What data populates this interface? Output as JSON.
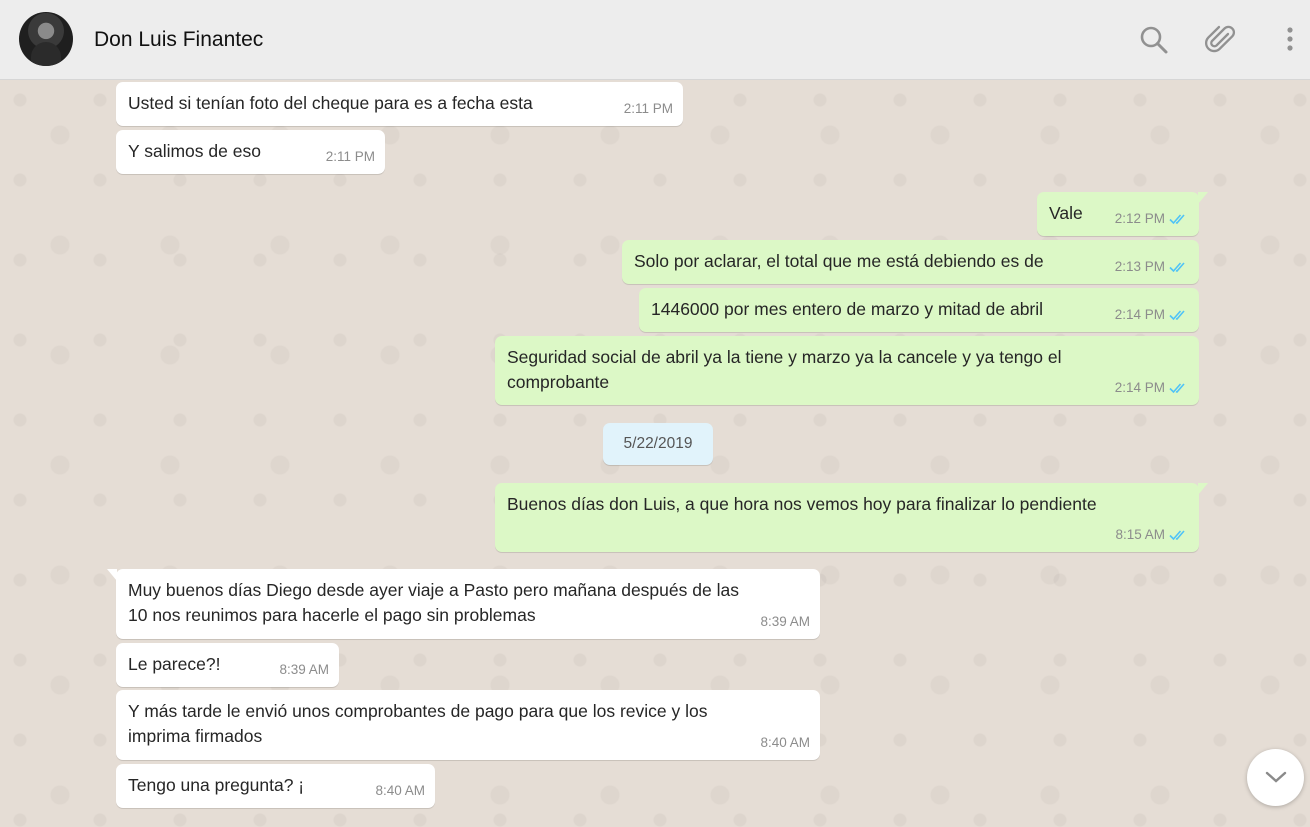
{
  "header": {
    "contact_name": "Don Luis Finantec",
    "icons": [
      "search-icon",
      "attach-icon",
      "menu-icon"
    ]
  },
  "date_separator": "5/22/2019",
  "messages": [
    {
      "dir": "in",
      "text": "Usted si tenían foto del cheque para es a fecha esta",
      "time": "2:11 PM"
    },
    {
      "dir": "in",
      "text": "Y salimos de eso",
      "time": "2:11 PM"
    },
    {
      "dir": "out",
      "text": "Vale",
      "time": "2:12 PM",
      "read": true
    },
    {
      "dir": "out",
      "text": "Solo por aclarar, el total que me está debiendo es de",
      "time": "2:13 PM",
      "read": true
    },
    {
      "dir": "out",
      "text": "1446000 por mes entero de marzo y mitad de abril",
      "time": "2:14 PM",
      "read": true
    },
    {
      "dir": "out",
      "text": "Seguridad social de abril ya la tiene y marzo ya la cancele y ya tengo el comprobante",
      "time": "2:14 PM",
      "read": true
    },
    {
      "dir": "out",
      "text": "Buenos días don Luis, a que hora nos vemos hoy para finalizar lo pendiente",
      "time": "8:15 AM",
      "read": true
    },
    {
      "dir": "in",
      "text": "Muy buenos días Diego desde ayer viaje a Pasto pero mañana después de las 10 nos reunimos para hacerle el pago sin problemas",
      "time": "8:39 AM"
    },
    {
      "dir": "in",
      "text": "Le parece?!",
      "time": "8:39 AM"
    },
    {
      "dir": "in",
      "text": "Y más tarde le envió unos comprobantes de pago para que los revice y los imprima firmados",
      "time": "8:40 AM"
    },
    {
      "dir": "in",
      "text": "Tengo una pregunta? ¡",
      "time": "8:40 AM"
    }
  ],
  "colors": {
    "incoming": "#ffffff",
    "outgoing": "#dcf8c6",
    "read_ticks": "#4fc3f7",
    "background": "#e5ddd5"
  }
}
